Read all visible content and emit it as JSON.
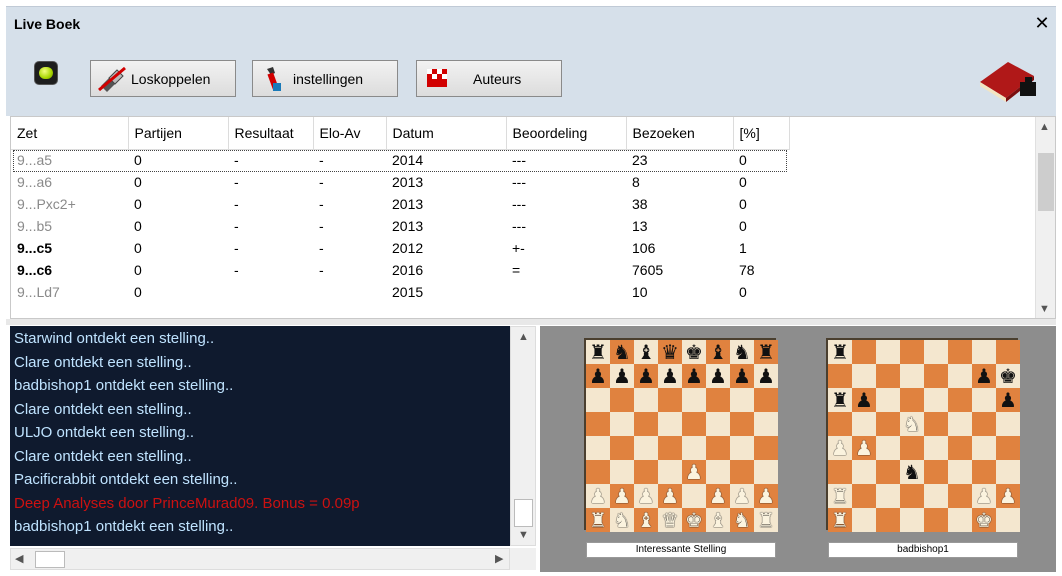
{
  "title": "Live Boek",
  "close_label": "✕",
  "toolbar": {
    "disconnect_label": "Loskoppelen",
    "settings_label": "instellingen",
    "authors_label": "Auteurs"
  },
  "table": {
    "columns": [
      "Zet",
      "Partijen",
      "Resultaat",
      "Elo-Av",
      "Datum",
      "Beoordeling",
      "Bezoeken",
      "[%]"
    ],
    "rows": [
      {
        "move": "9...a5",
        "games": "0",
        "result": "-",
        "elo": "-",
        "date": "2014",
        "eval": "---",
        "visits": "23",
        "pct": "0",
        "style": "gray"
      },
      {
        "move": "9...a6",
        "games": "0",
        "result": "-",
        "elo": "-",
        "date": "2013",
        "eval": "---",
        "visits": "8",
        "pct": "0",
        "style": "gray"
      },
      {
        "move": "9...Pxc2+",
        "games": "0",
        "result": "-",
        "elo": "-",
        "date": "2013",
        "eval": "---",
        "visits": "38",
        "pct": "0",
        "style": "gray"
      },
      {
        "move": "9...b5",
        "games": "0",
        "result": "-",
        "elo": "-",
        "date": "2013",
        "eval": "---",
        "visits": "13",
        "pct": "0",
        "style": "gray"
      },
      {
        "move": "9...c5",
        "games": "0",
        "result": "-",
        "elo": "-",
        "date": "2012",
        "eval": "+-",
        "visits": "106",
        "pct": "1",
        "style": "bold"
      },
      {
        "move": "9...c6",
        "games": "0",
        "result": "-",
        "elo": "-",
        "date": "2016",
        "eval": "=",
        "visits": "7605",
        "pct": "78",
        "style": "bold"
      },
      {
        "move": "9...Ld7",
        "games": "0",
        "result": "",
        "elo": "",
        "date": "2015",
        "eval": "",
        "visits": "10",
        "pct": "0",
        "style": "gray"
      }
    ]
  },
  "log": [
    {
      "text": "Starwind ontdekt een stelling..",
      "color": "#bfe3ff"
    },
    {
      "text": "Clare ontdekt een stelling..",
      "color": "#bfe3ff"
    },
    {
      "text": "badbishop1 ontdekt een stelling..",
      "color": "#bfe3ff"
    },
    {
      "text": "Clare ontdekt een stelling..",
      "color": "#bfe3ff"
    },
    {
      "text": "ULJO ontdekt een stelling..",
      "color": "#bfe3ff"
    },
    {
      "text": "Clare ontdekt een stelling..",
      "color": "#bfe3ff"
    },
    {
      "text": "Pacificrabbit ontdekt een stelling..",
      "color": "#bfe3ff"
    },
    {
      "text": "Deep Analyses door PrinceMurad09. Bonus = 0.09p",
      "color": "#cc1111"
    },
    {
      "text": "badbishop1 ontdekt een stelling..",
      "color": "#bfe3ff"
    }
  ],
  "boards": [
    {
      "caption": "Interessante Stelling",
      "position": [
        "rnbqkbnr",
        "pppppppp",
        "........",
        "........",
        "........",
        "....P...",
        "PPPP.PPP",
        "RNBQKBNR"
      ]
    },
    {
      "caption": "badbishop1",
      "position": [
        "r.......",
        "......pk",
        "rp.....p",
        "...N....",
        "PP......",
        "...n....",
        "R.....PP",
        "R.....K."
      ]
    }
  ],
  "colors": {
    "titlebar_bg": "#d6e0ea",
    "log_bg": "#0f1a2e",
    "log_text": "#bfe3ff",
    "log_highlight": "#cc1111",
    "board_light": "#f4e7cf",
    "board_dark": "#e0823f"
  },
  "icons": [
    "status-led-icon",
    "disconnect-plug-icon",
    "wrench-icon",
    "flag-icon",
    "book-icon",
    "close-icon",
    "scroll-up-icon",
    "scroll-down-icon",
    "scroll-left-icon",
    "scroll-right-icon"
  ]
}
